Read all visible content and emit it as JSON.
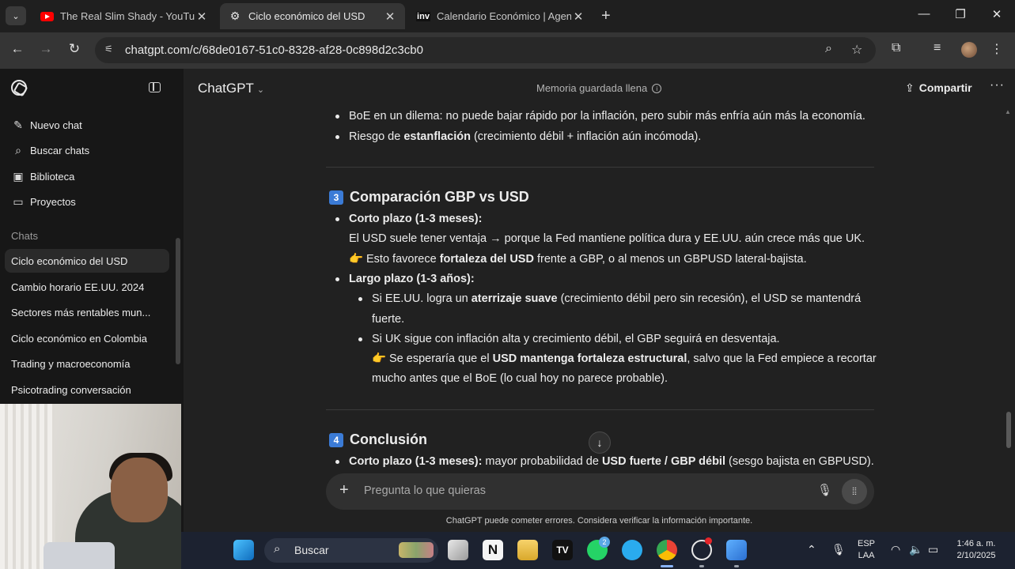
{
  "browser": {
    "tabs": [
      {
        "title": "The Real Slim Shady - YouTube",
        "favicon": "youtube-icon"
      },
      {
        "title": "Ciclo económico del USD",
        "favicon": "chatgpt-icon"
      },
      {
        "title": "Calendario Económico | Agenda",
        "favicon": "investing-icon"
      }
    ],
    "favicon_inv": "inv",
    "url": "chatgpt.com/c/68de0167-51c0-8328-af28-0c898d2c3cb0"
  },
  "sidebar": {
    "menu": [
      {
        "label": "Nuevo chat",
        "icon": "new-chat-icon"
      },
      {
        "label": "Buscar chats",
        "icon": "search-icon"
      },
      {
        "label": "Biblioteca",
        "icon": "library-icon"
      },
      {
        "label": "Proyectos",
        "icon": "folder-icon"
      }
    ],
    "chats_label": "Chats",
    "chats": [
      "Ciclo económico del USD",
      "Cambio horario EE.UU. 2024",
      "Sectores más rentables mun...",
      "Ciclo económico en Colombia",
      "Trading y macroeconomía",
      "Psicotrading conversación"
    ]
  },
  "header": {
    "model": "ChatGPT",
    "memory": "Memoria guardada llena",
    "share": "Compartir"
  },
  "message": {
    "top_bullets": [
      {
        "a": "BoE en un dilema: no puede bajar rápido por la inflación, pero subir más enfría aún más la economía."
      },
      {
        "a": "Riesgo de ",
        "b": "estanflación",
        "c": " (crecimiento débil + inflación aún incómoda)."
      }
    ],
    "section3": {
      "num": "3",
      "title": "Comparación GBP vs USD",
      "short_term": {
        "label": "Corto plazo (1-3 meses):",
        "line1": "El USD suele tener ventaja → porque la Fed mantiene política dura y EE.UU. aún crece más que UK.",
        "line2_a": "Esto favorece ",
        "line2_b": "fortaleza del USD",
        "line2_c": " frente a GBP, o al menos un GBPUSD lateral-bajista."
      },
      "long_term": {
        "label": "Largo plazo (1-3 años):",
        "sub1_a": "Si EE.UU. logra un ",
        "sub1_b": "aterrizaje suave",
        "sub1_c": " (crecimiento débil pero sin recesión), el USD se mantendrá",
        "sub1_d": "fuerte.",
        "sub2": "Si UK sigue con inflación alta y crecimiento débil, el GBP seguirá en desventaja.",
        "sub2b_a": "Se esperaría que el ",
        "sub2b_b": "USD mantenga fortaleza estructural",
        "sub2b_c": ", salvo que la Fed empiece a recortar",
        "sub2b_d": "mucho antes que el BoE (lo cual hoy no parece probable)."
      }
    },
    "section4": {
      "num": "4",
      "title": "Conclusión",
      "bullet_a": "Corto plazo (1-3 meses):",
      "bullet_b": " mayor probabilidad de ",
      "bullet_c": "USD fuerte / GBP débil",
      "bullet_d": " (sesgo bajista en GBPUSD)."
    }
  },
  "composer": {
    "placeholder": "Pregunta lo que quieras",
    "disclaimer": "ChatGPT puede cometer errores. Considera verificar la información importante."
  },
  "taskbar": {
    "search": "Buscar",
    "whatsapp_badge": "2",
    "lang_line1": "ESP",
    "lang_line2": "LAA",
    "time": "1:46 a. m.",
    "date": "2/10/2025"
  },
  "colors": {
    "accent_keycap": "#3b7bd6",
    "background": "#212121",
    "sidebar": "#171717"
  }
}
